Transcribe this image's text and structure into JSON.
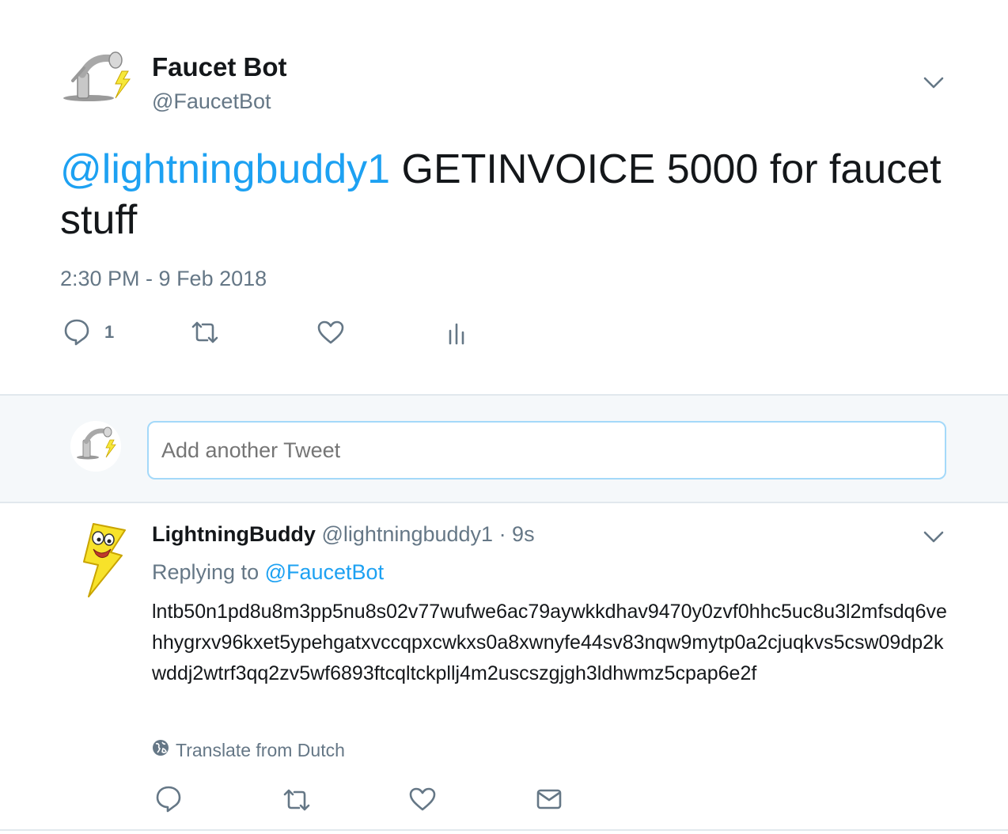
{
  "main_tweet": {
    "display_name": "Faucet Bot",
    "handle": "@FaucetBot",
    "mention": "@lightningbuddy1",
    "body": " GETINVOICE 5000 for faucet stuff",
    "timestamp": "2:30 PM - 9 Feb 2018",
    "reply_count": "1",
    "icons": [
      "reply-icon",
      "retweet-icon",
      "like-icon",
      "analytics-icon",
      "chevron-down-icon"
    ]
  },
  "compose": {
    "placeholder": "Add another Tweet"
  },
  "reply_tweet": {
    "display_name": "LightningBuddy",
    "handle": "@lightningbuddy1",
    "time": "· 9s",
    "replying_prefix": "Replying to ",
    "replying_to": "@FaucetBot",
    "body": "lntb50n1pd8u8m3pp5nu8s02v77wufwe6ac79aywkkdhav9470y0zvf0hhc5uc8u3l2mfsdq6vehhygrxv96kxet5ypehgatxvccqpxcwkxs0a8xwnyfe44sv83nqw9mytp0a2cjuqkvs5csw09dp2kwddj2wtrf3qq2zv5wf6893ftcqltckpllj4m2uscszgjgh3ldhwmz5cpap6e2f",
    "translate": "Translate from Dutch",
    "icons": [
      "reply-icon",
      "retweet-icon",
      "like-icon",
      "message-icon",
      "globe-icon",
      "chevron-down-icon"
    ]
  },
  "colors": {
    "link": "#1da1f2",
    "muted": "#657786",
    "text": "#14171a",
    "compose_bg": "#f5f8fa",
    "input_border": "#a4d9f9"
  }
}
